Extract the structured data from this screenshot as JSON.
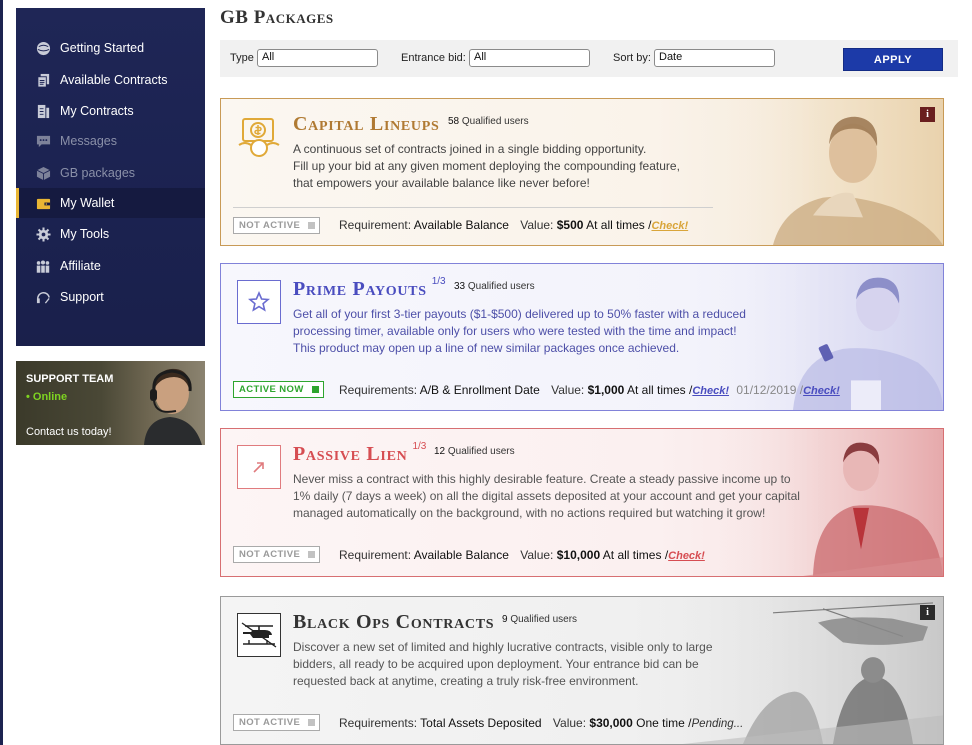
{
  "sidebar": {
    "items": [
      {
        "label": "Getting Started",
        "icon": "globe-icon"
      },
      {
        "label": "Available Contracts",
        "icon": "contracts-icon"
      },
      {
        "label": "My Contracts",
        "icon": "document-icon"
      },
      {
        "label": "Messages",
        "icon": "chat-icon"
      },
      {
        "label": "GB packages",
        "icon": "box-icon"
      },
      {
        "label": "My Wallet",
        "icon": "wallet-icon"
      },
      {
        "label": "My Tools",
        "icon": "gear-icon"
      },
      {
        "label": "Affiliate",
        "icon": "users-icon"
      },
      {
        "label": "Support",
        "icon": "headset-icon"
      }
    ],
    "active": "My Wallet"
  },
  "support": {
    "title": "SUPPORT TEAM",
    "status": "• Online",
    "cta": "Contact us today!"
  },
  "page": {
    "title": "GB Packages"
  },
  "filters": {
    "type_label": "Type",
    "type_value": "All",
    "bid_label": "Entrance bid:",
    "bid_value": "All",
    "sort_label": "Sort by:",
    "sort_value": "Date",
    "apply_label": "APPLY"
  },
  "packages": [
    {
      "title": "Capital Lineups",
      "fraction": "",
      "qualified_count": "58",
      "qualified_label": "Qualified users",
      "description": [
        "A continuous set of contracts joined in a single bidding opportunity.",
        "Fill up your bid at any given moment deploying the compounding feature,",
        "that empowers your available balance like never before!"
      ],
      "status": "NOT ACTIVE",
      "req_label": "Requirement:",
      "req_value": "Available Balance",
      "value_label": "Value:",
      "value_amount": "$500",
      "value_period": "At all times /",
      "check": "Check!",
      "color": "#b07a33"
    },
    {
      "title": "Prime Payouts",
      "fraction": "1/3",
      "qualified_count": "33",
      "qualified_label": "Qualified users",
      "description": [
        "Get all of your first 3-tier payouts ($1-$500) delivered up to 50% faster with a reduced",
        "processing timer, available only for users who were tested with the time and impact!",
        "This product may open up a line of new similar packages once achieved."
      ],
      "status": "ACTIVE NOW",
      "req_label": "Requirements:",
      "req_value": "A/B & Enrollment Date",
      "value_label": "Value:",
      "value_amount": "$1,000",
      "value_period": "At all times /",
      "check": "Check!",
      "date": "01/12/2019 /",
      "check2": "Check!",
      "color": "#4a4dbf"
    },
    {
      "title": "Passive Lien",
      "fraction": "1/3",
      "qualified_count": "12",
      "qualified_label": "Qualified users",
      "description": [
        "Never miss a contract with this highly desirable feature. Create a steady passive income up to",
        "1% daily (7 days a week) on all the digital assets deposited at your account and get your capital",
        "managed automatically on the background, with no actions required but watching it grow!"
      ],
      "status": "NOT ACTIVE",
      "req_label": "Requirement:",
      "req_value": "Available Balance",
      "value_label": "Value:",
      "value_amount": "$10,000",
      "value_period": "At all times /",
      "check": "Check!",
      "color": "#d64d52"
    },
    {
      "title": "Black Ops Contracts",
      "fraction": "",
      "qualified_count": "9",
      "qualified_label": "Qualified users",
      "description": [
        "Discover a new set of limited and highly lucrative contracts, visible only to large",
        "bidders, all ready to be acquired upon deployment. Your entrance bid can be",
        "requested back at anytime, creating a truly risk-free environment."
      ],
      "status": "NOT ACTIVE",
      "req_label": "Requirements:",
      "req_value": "Total Assets Deposited",
      "value_label": "Value:",
      "value_amount": "$30,000",
      "value_period": "One time /",
      "pending": "Pending...",
      "color": "#333333"
    }
  ],
  "info_icon_glyph": "i"
}
